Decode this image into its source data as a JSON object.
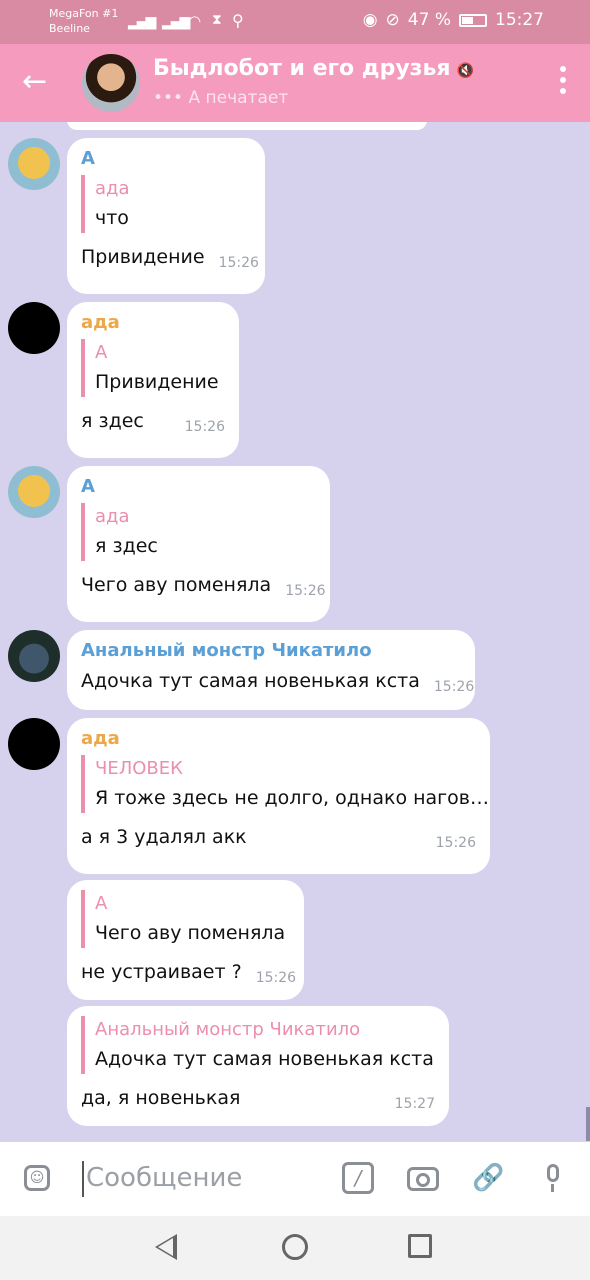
{
  "status_bar": {
    "carrier_1": "MegaFon #1",
    "carrier_2": "Beeline",
    "battery": "47 %",
    "time": "15:27"
  },
  "header": {
    "title": "Быдлобот и его друзья",
    "status": "••• А печатает"
  },
  "messages": [
    {
      "sender": "А",
      "quote_name": "ада",
      "quote_text": "что",
      "text": "Привидение",
      "time": "15:26"
    },
    {
      "sender": "ада",
      "quote_name": "А",
      "quote_text": "Привидение",
      "text": "я здес",
      "time": "15:26"
    },
    {
      "sender": "А",
      "quote_name": "ада",
      "quote_text": "я здес",
      "text": "Чего аву поменяла",
      "time": "15:26"
    },
    {
      "sender": "Анальный монстр Чикатило",
      "text": "Адочка тут самая новенькая кста",
      "time": "15:26"
    },
    {
      "sender": "ада",
      "quote_name": "ЧЕЛОВЕК",
      "quote_text": "Я тоже здесь не долго, однако нагов…",
      "text": "а я 3 удалял акк",
      "time": "15:26"
    },
    {
      "quote_name": "А",
      "quote_text": "Чего аву поменяла",
      "text": "не устраивает ?",
      "time": "15:26"
    },
    {
      "quote_name": "Анальный монстр Чикатило",
      "quote_text": "Адочка тут самая новенькая кста",
      "text": "да, я новенькая",
      "time": "15:27"
    }
  ],
  "input": {
    "placeholder": "Сообщение"
  },
  "colors": {
    "header": "#f59bbd",
    "statusbar": "#d98ba3",
    "chat_background": "#d6d1ec",
    "sender_blue": "#5a9fd6",
    "sender_orange": "#eaa84a",
    "quote_pink": "#eb8fad"
  },
  "icons": [
    "back-arrow-icon",
    "mute-icon",
    "more-vert-icon",
    "sticker-icon",
    "bot-command-icon",
    "camera-icon",
    "attach-icon",
    "mic-icon"
  ]
}
